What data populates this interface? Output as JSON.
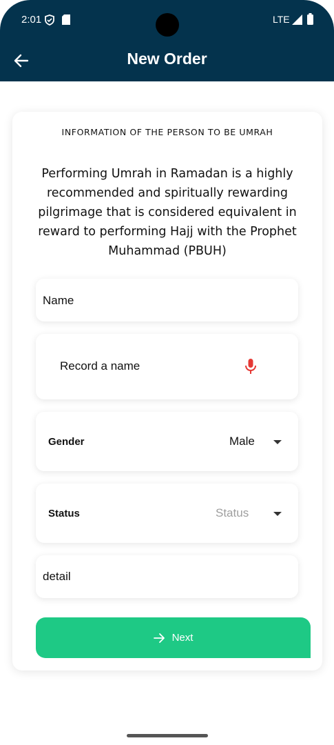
{
  "status_bar": {
    "time": "2:01",
    "network": "LTE"
  },
  "app_bar": {
    "title": "New Order"
  },
  "form": {
    "heading": "INFORMATION OF THE PERSON TO BE UMRAH",
    "intro": "Performing Umrah in Ramadan is a highly recommended and spiritually rewarding pilgrimage that is considered equivalent in reward to performing Hajj with the Prophet Muhammad (PBUH)",
    "name_placeholder": "Name",
    "record_label": "Record a name",
    "gender_label": "Gender",
    "gender_value": "Male",
    "status_label": "Status",
    "status_placeholder": "Status",
    "detail_placeholder": "detail",
    "next_label": "Next"
  },
  "colors": {
    "app_bar": "#04334d",
    "accent": "#1ec985",
    "mic": "#e53935",
    "placeholder": "#9e9e9e"
  }
}
